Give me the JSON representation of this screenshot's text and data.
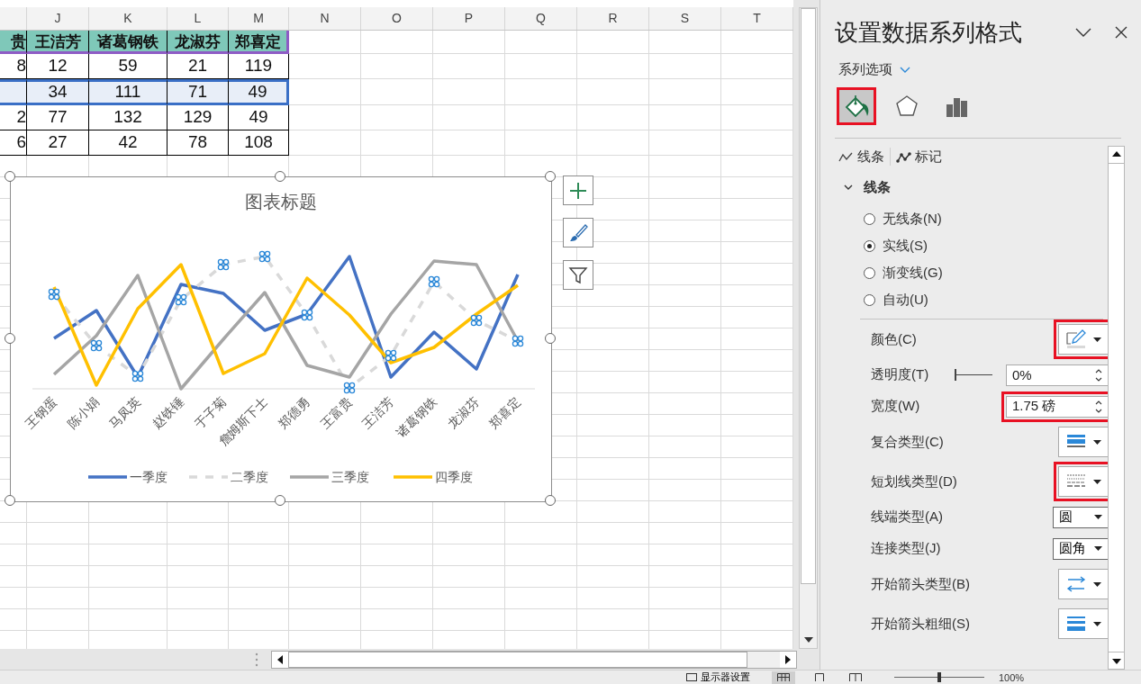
{
  "sheet": {
    "columns": [
      "J",
      "K",
      "L",
      "M",
      "N",
      "O",
      "P",
      "Q",
      "R",
      "S",
      "T"
    ],
    "rows": [
      {
        "kind": "header",
        "partial": "贵",
        "cells": [
          "王洁芳",
          "诸葛钢铁",
          "龙淑芬",
          "郑喜定"
        ],
        "selected": false
      },
      {
        "kind": "data",
        "partial": "8",
        "cells": [
          "12",
          "59",
          "21",
          "119"
        ],
        "selected": false
      },
      {
        "kind": "data",
        "cells": [
          "34",
          "111",
          "71",
          "49"
        ],
        "selected": true
      },
      {
        "kind": "data",
        "partial": "2",
        "cells": [
          "77",
          "132",
          "129",
          "49"
        ],
        "selected": false
      },
      {
        "kind": "data",
        "partial": "6",
        "cells": [
          "27",
          "42",
          "78",
          "108"
        ],
        "selected": false
      }
    ]
  },
  "chart": {
    "title": "图表标题",
    "categories": [
      "王钢蛋",
      "陈小娟",
      "马凤英",
      "赵铁锤",
      "于子菊",
      "詹姆斯下士",
      "郑德勇",
      "王富贵",
      "王洁芳",
      "诸葛钢铁",
      "龙淑芬",
      "郑喜定"
    ],
    "series": [
      {
        "name": "一季度",
        "color": "#4472c4",
        "kind": "solid",
        "selected": false
      },
      {
        "name": "二季度",
        "color": "#d9d9d9",
        "kind": "dashed",
        "selected": true
      },
      {
        "name": "三季度",
        "color": "#a5a5a5",
        "kind": "solid",
        "selected": false
      },
      {
        "name": "四季度",
        "color": "#ffc000",
        "kind": "solid",
        "selected": false
      }
    ]
  },
  "chart_tools": [
    {
      "kind": "add"
    },
    {
      "kind": "style"
    },
    {
      "kind": "filter"
    }
  ],
  "panel": {
    "title": "设置数据系列格式",
    "subtitle": "系列选项",
    "icon_tabs": [
      {
        "kind": "fill",
        "selected": true
      },
      {
        "kind": "effects",
        "selected": false
      },
      {
        "kind": "series",
        "selected": false
      }
    ],
    "sub_tabs": [
      {
        "kind": "line",
        "label": "线条"
      },
      {
        "kind": "marker",
        "label": "标记"
      }
    ],
    "section": {
      "label": "线条",
      "expanded": true
    },
    "radios": [
      {
        "label": "无线条(N)",
        "selected": false
      },
      {
        "label": "实线(S)",
        "selected": true
      },
      {
        "label": "渐变线(G)",
        "selected": false
      },
      {
        "label": "自动(U)",
        "selected": false
      }
    ],
    "properties": [
      {
        "kind": "color",
        "label": "颜色(C)",
        "highlighted": true
      },
      {
        "kind": "slider-spinner",
        "label": "透明度(T)",
        "level": 0,
        "value": "0%",
        "highlighted": false
      },
      {
        "kind": "spinner",
        "label": "宽度(W)",
        "value": "1.75 磅",
        "highlighted": true
      },
      {
        "kind": "compound",
        "label": "复合类型(C)",
        "highlighted": false
      },
      {
        "kind": "dash",
        "label": "短划线类型(D)",
        "highlighted": true
      },
      {
        "kind": "select",
        "label": "线端类型(A)",
        "value": "圆",
        "highlighted": false
      },
      {
        "kind": "select",
        "label": "连接类型(J)",
        "value": "圆角",
        "highlighted": false
      },
      {
        "kind": "arrow",
        "label": "开始箭头类型(B)",
        "highlighted": false
      },
      {
        "kind": "arrow-size",
        "label": "开始箭头粗细(S)",
        "highlighted": false
      }
    ]
  },
  "status_bar": {
    "display_settings": "显示器设置",
    "zoom_slider": {
      "level": 0.5
    },
    "zoom": "100%"
  }
}
